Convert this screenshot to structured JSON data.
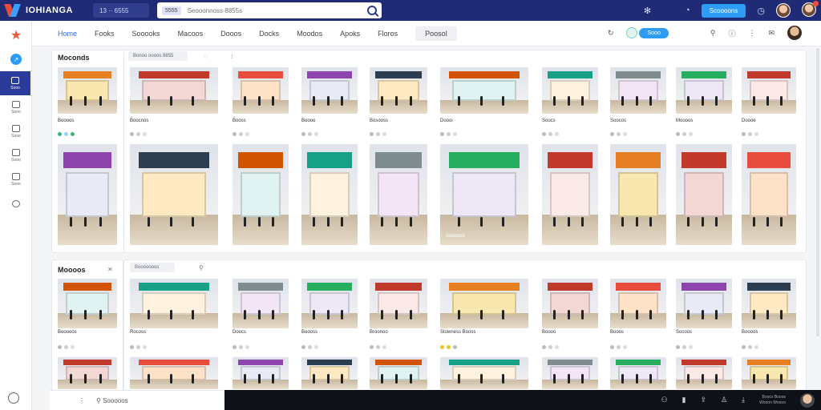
{
  "header": {
    "brand": "IOHIANGA",
    "workspace": "13 ·· 6555",
    "search_tag": "5555",
    "search_placeholder": "Seooonnoss 8855s",
    "cta": "Scoooons"
  },
  "nav": {
    "tabs": [
      "Home",
      "Fooks",
      "Sooooks",
      "Macoos",
      "Dooos",
      "Docks",
      "Moodos",
      "Apoks",
      "Floros",
      "Poosol"
    ],
    "toggle_label": "Sooo"
  },
  "rail": {
    "items": [
      "",
      "",
      "Sooo",
      "Sooo",
      "Sooo",
      "Sooo",
      "Sooo"
    ]
  },
  "section1": {
    "title": "Moconds",
    "chip": "Bonoo oooos 8855",
    "captions": [
      "Boooos",
      "Boocnos",
      "Booss",
      "Boooo",
      "Bosooss",
      "Doooi",
      "Soocs",
      "Soocos",
      "Moooos",
      "Doooe"
    ],
    "row2_label": "Sooooos"
  },
  "section2": {
    "title": "Moooos",
    "chip": "Booooooos",
    "captions": [
      "Booooos",
      "Rocoss",
      "Doocs",
      "Boooss",
      "Broonoo",
      "Stowness Booss",
      "Boooo",
      "Booos",
      "Socoos",
      "Boooos"
    ]
  },
  "bottom": {
    "footer_label": "Sooooos",
    "tray_line1": "Boocs Booos",
    "tray_line2": "Wooon Woooo"
  },
  "colors": {
    "header_bg": "#1f2b74",
    "accent": "#2d9cf4",
    "active_rail": "#2a3b9a"
  }
}
